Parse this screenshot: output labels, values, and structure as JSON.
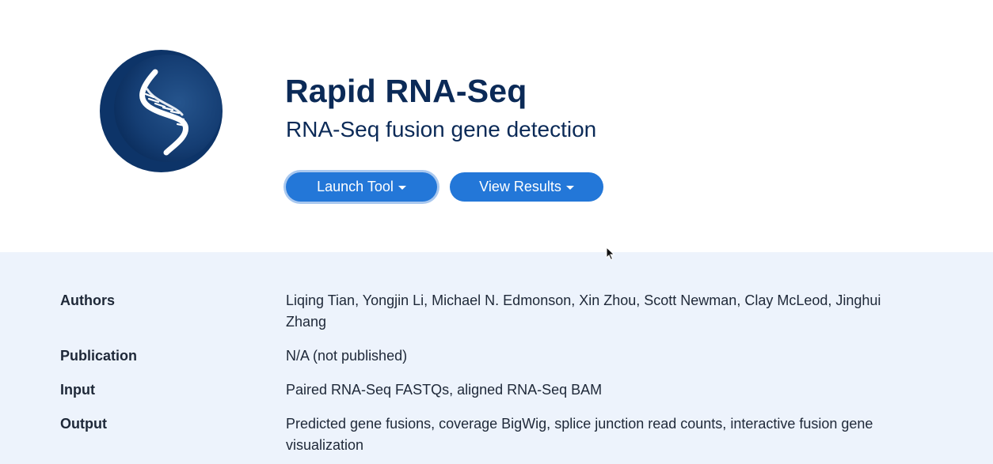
{
  "tool": {
    "title": "Rapid RNA-Seq",
    "subtitle": "RNA-Seq fusion gene detection",
    "logo_icon": "dna-helix-icon",
    "colors": {
      "logo_bg": "#0d3468",
      "button": "#2377d8",
      "title": "#0b2a57",
      "details_bg": "#edf3fc"
    }
  },
  "actions": {
    "launch_label": "Launch Tool",
    "results_label": "View Results"
  },
  "details": {
    "rows": [
      {
        "label": "Authors",
        "value": "Liqing Tian, Yongjin Li, Michael N. Edmonson, Xin Zhou, Scott Newman, Clay McLeod, Jinghui Zhang"
      },
      {
        "label": "Publication",
        "value": "N/A (not published)"
      },
      {
        "label": "Input",
        "value": "Paired RNA-Seq FASTQs, aligned RNA-Seq BAM"
      },
      {
        "label": "Output",
        "value": "Predicted gene fusions, coverage BigWig, splice junction read counts, interactive fusion gene visualization"
      }
    ]
  }
}
